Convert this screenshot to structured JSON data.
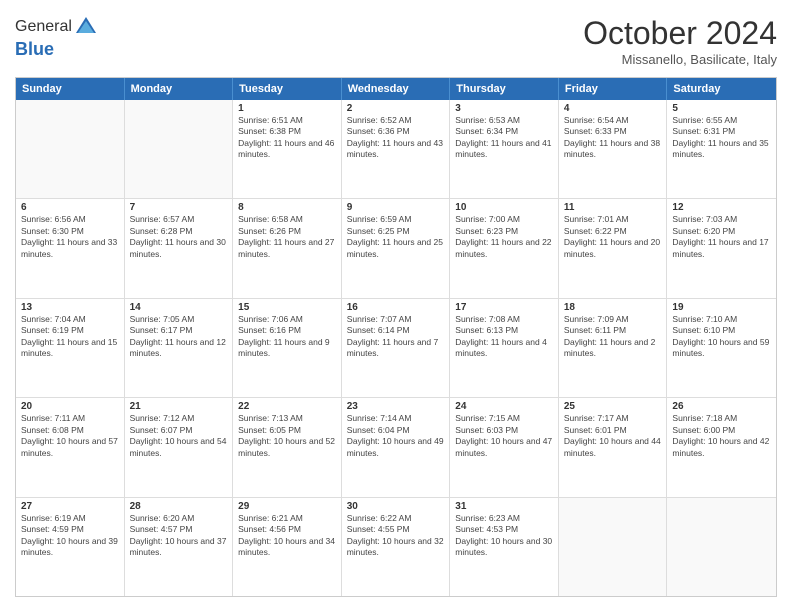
{
  "logo": {
    "general": "General",
    "blue": "Blue"
  },
  "header": {
    "month": "October 2024",
    "location": "Missanello, Basilicate, Italy"
  },
  "weekdays": [
    "Sunday",
    "Monday",
    "Tuesday",
    "Wednesday",
    "Thursday",
    "Friday",
    "Saturday"
  ],
  "weeks": [
    [
      {
        "day": "",
        "info": ""
      },
      {
        "day": "",
        "info": ""
      },
      {
        "day": "1",
        "info": "Sunrise: 6:51 AM\nSunset: 6:38 PM\nDaylight: 11 hours and 46 minutes."
      },
      {
        "day": "2",
        "info": "Sunrise: 6:52 AM\nSunset: 6:36 PM\nDaylight: 11 hours and 43 minutes."
      },
      {
        "day": "3",
        "info": "Sunrise: 6:53 AM\nSunset: 6:34 PM\nDaylight: 11 hours and 41 minutes."
      },
      {
        "day": "4",
        "info": "Sunrise: 6:54 AM\nSunset: 6:33 PM\nDaylight: 11 hours and 38 minutes."
      },
      {
        "day": "5",
        "info": "Sunrise: 6:55 AM\nSunset: 6:31 PM\nDaylight: 11 hours and 35 minutes."
      }
    ],
    [
      {
        "day": "6",
        "info": "Sunrise: 6:56 AM\nSunset: 6:30 PM\nDaylight: 11 hours and 33 minutes."
      },
      {
        "day": "7",
        "info": "Sunrise: 6:57 AM\nSunset: 6:28 PM\nDaylight: 11 hours and 30 minutes."
      },
      {
        "day": "8",
        "info": "Sunrise: 6:58 AM\nSunset: 6:26 PM\nDaylight: 11 hours and 27 minutes."
      },
      {
        "day": "9",
        "info": "Sunrise: 6:59 AM\nSunset: 6:25 PM\nDaylight: 11 hours and 25 minutes."
      },
      {
        "day": "10",
        "info": "Sunrise: 7:00 AM\nSunset: 6:23 PM\nDaylight: 11 hours and 22 minutes."
      },
      {
        "day": "11",
        "info": "Sunrise: 7:01 AM\nSunset: 6:22 PM\nDaylight: 11 hours and 20 minutes."
      },
      {
        "day": "12",
        "info": "Sunrise: 7:03 AM\nSunset: 6:20 PM\nDaylight: 11 hours and 17 minutes."
      }
    ],
    [
      {
        "day": "13",
        "info": "Sunrise: 7:04 AM\nSunset: 6:19 PM\nDaylight: 11 hours and 15 minutes."
      },
      {
        "day": "14",
        "info": "Sunrise: 7:05 AM\nSunset: 6:17 PM\nDaylight: 11 hours and 12 minutes."
      },
      {
        "day": "15",
        "info": "Sunrise: 7:06 AM\nSunset: 6:16 PM\nDaylight: 11 hours and 9 minutes."
      },
      {
        "day": "16",
        "info": "Sunrise: 7:07 AM\nSunset: 6:14 PM\nDaylight: 11 hours and 7 minutes."
      },
      {
        "day": "17",
        "info": "Sunrise: 7:08 AM\nSunset: 6:13 PM\nDaylight: 11 hours and 4 minutes."
      },
      {
        "day": "18",
        "info": "Sunrise: 7:09 AM\nSunset: 6:11 PM\nDaylight: 11 hours and 2 minutes."
      },
      {
        "day": "19",
        "info": "Sunrise: 7:10 AM\nSunset: 6:10 PM\nDaylight: 10 hours and 59 minutes."
      }
    ],
    [
      {
        "day": "20",
        "info": "Sunrise: 7:11 AM\nSunset: 6:08 PM\nDaylight: 10 hours and 57 minutes."
      },
      {
        "day": "21",
        "info": "Sunrise: 7:12 AM\nSunset: 6:07 PM\nDaylight: 10 hours and 54 minutes."
      },
      {
        "day": "22",
        "info": "Sunrise: 7:13 AM\nSunset: 6:05 PM\nDaylight: 10 hours and 52 minutes."
      },
      {
        "day": "23",
        "info": "Sunrise: 7:14 AM\nSunset: 6:04 PM\nDaylight: 10 hours and 49 minutes."
      },
      {
        "day": "24",
        "info": "Sunrise: 7:15 AM\nSunset: 6:03 PM\nDaylight: 10 hours and 47 minutes."
      },
      {
        "day": "25",
        "info": "Sunrise: 7:17 AM\nSunset: 6:01 PM\nDaylight: 10 hours and 44 minutes."
      },
      {
        "day": "26",
        "info": "Sunrise: 7:18 AM\nSunset: 6:00 PM\nDaylight: 10 hours and 42 minutes."
      }
    ],
    [
      {
        "day": "27",
        "info": "Sunrise: 6:19 AM\nSunset: 4:59 PM\nDaylight: 10 hours and 39 minutes."
      },
      {
        "day": "28",
        "info": "Sunrise: 6:20 AM\nSunset: 4:57 PM\nDaylight: 10 hours and 37 minutes."
      },
      {
        "day": "29",
        "info": "Sunrise: 6:21 AM\nSunset: 4:56 PM\nDaylight: 10 hours and 34 minutes."
      },
      {
        "day": "30",
        "info": "Sunrise: 6:22 AM\nSunset: 4:55 PM\nDaylight: 10 hours and 32 minutes."
      },
      {
        "day": "31",
        "info": "Sunrise: 6:23 AM\nSunset: 4:53 PM\nDaylight: 10 hours and 30 minutes."
      },
      {
        "day": "",
        "info": ""
      },
      {
        "day": "",
        "info": ""
      }
    ]
  ]
}
